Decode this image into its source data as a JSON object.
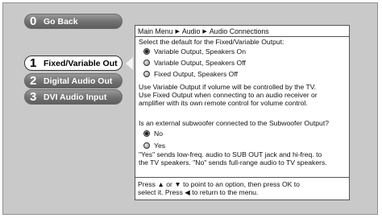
{
  "menu": {
    "items": [
      {
        "num": "0",
        "label": "Go Back"
      },
      {
        "num": "1",
        "label": "Fixed/Variable Out"
      },
      {
        "num": "2",
        "label": "Digital Audio Out"
      },
      {
        "num": "3",
        "label": "DVI Audio Input"
      }
    ],
    "selected_index": 1
  },
  "breadcrumb": {
    "items": [
      "Main Menu",
      "Audio",
      "Audio Connections"
    ],
    "separator": "▶"
  },
  "output": {
    "prompt": "Select the default for the Fixed/Variable Output:",
    "options": [
      "Variable Output, Speakers On",
      "Variable Output, Speakers Off",
      "Fixed Output, Speakers Off"
    ],
    "selected_index": 0
  },
  "info": {
    "line1": "Use Variable Output if volume will be controlled by the TV.",
    "line2": "Use Fixed Output when connecting to an audio receiver or",
    "line3": "amplifier with its own remote control for volume control."
  },
  "subwoofer": {
    "question": "Is an external subwoofer connected to the Subwoofer Output?",
    "options": [
      "No",
      "Yes"
    ],
    "selected_index": 0,
    "note1": "\"Yes\" sends low-freq. audio to SUB OUT jack and hi-freq. to",
    "note2": "the TV speakers. \"No\" sends full-range audio to TV speakers."
  },
  "footer": {
    "line1": "Press ▲ or ▼ to point to an option, then press OK to",
    "line2": "select it. Press ◀ to return to the menu."
  }
}
